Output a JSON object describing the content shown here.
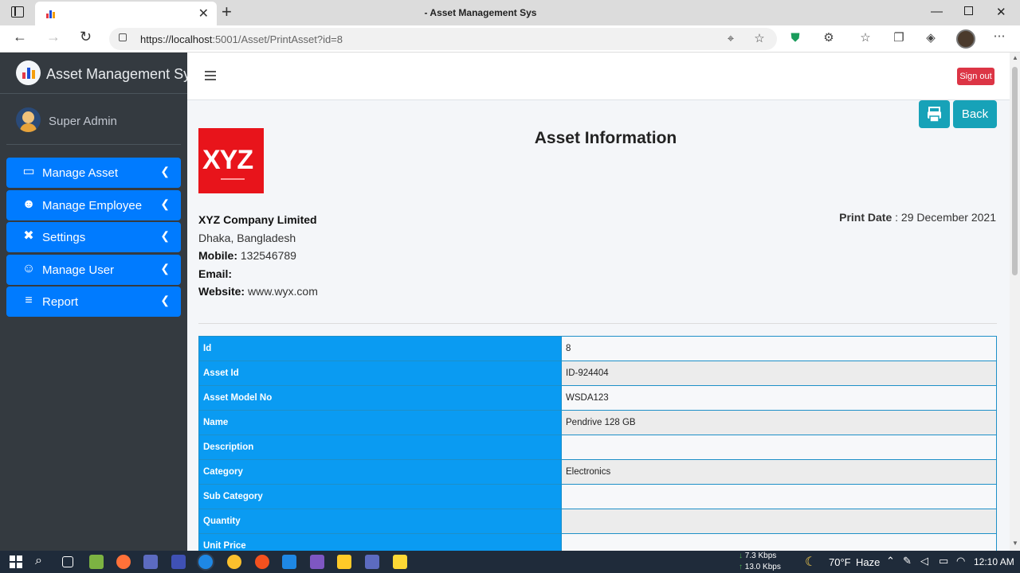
{
  "browser": {
    "tab_title": "- Asset Management Sys",
    "url_host": "https://localhost",
    "url_rest": ":5001/Asset/PrintAsset?id=8"
  },
  "sidebar": {
    "brand": "Asset Management Sys",
    "user_name": "Super Admin",
    "items": [
      {
        "label": "Manage Asset",
        "icon": "box-open-icon",
        "glyph": "▭"
      },
      {
        "label": "Manage Employee",
        "icon": "users-icon",
        "glyph": "☻"
      },
      {
        "label": "Settings",
        "icon": "tools-icon",
        "glyph": "✖"
      },
      {
        "label": "Manage User",
        "icon": "user-cog-icon",
        "glyph": "☺"
      },
      {
        "label": "Report",
        "icon": "database-icon",
        "glyph": "≡"
      }
    ]
  },
  "header": {
    "signout": "Sign out"
  },
  "page": {
    "back_label": "Back",
    "title": "Asset Information",
    "logo_text": "XYZ",
    "company_name": "XYZ Company Limited",
    "address": "Dhaka, Bangladesh",
    "mobile_label": "Mobile:",
    "mobile": "132546789",
    "email_label": "Email:",
    "email": "",
    "website_label": "Website:",
    "website": "www.wyx.com",
    "print_date_label": "Print Date",
    "print_date": ": 29 December 2021"
  },
  "asset_table": [
    {
      "key": "Id",
      "value": "8"
    },
    {
      "key": "Asset Id",
      "value": "ID-924404"
    },
    {
      "key": "Asset Model No",
      "value": "WSDA123"
    },
    {
      "key": "Name",
      "value": "Pendrive 128 GB"
    },
    {
      "key": "Description",
      "value": ""
    },
    {
      "key": "Category",
      "value": "Electronics"
    },
    {
      "key": "Sub Category",
      "value": ""
    },
    {
      "key": "Quantity",
      "value": ""
    },
    {
      "key": "Unit Price",
      "value": ""
    }
  ],
  "taskbar": {
    "net_up": "7.3 Kbps",
    "net_down": "13.0 Kbps",
    "weather_temp": "70°F",
    "weather_desc": "Haze",
    "time": "12:10 AM"
  },
  "colors": {
    "sidebar_bg": "#343a40",
    "menu_active": "#007bff",
    "table_key_bg": "#0a9bf2",
    "accent_btn": "#17a2b8",
    "signout": "#dc3545"
  }
}
